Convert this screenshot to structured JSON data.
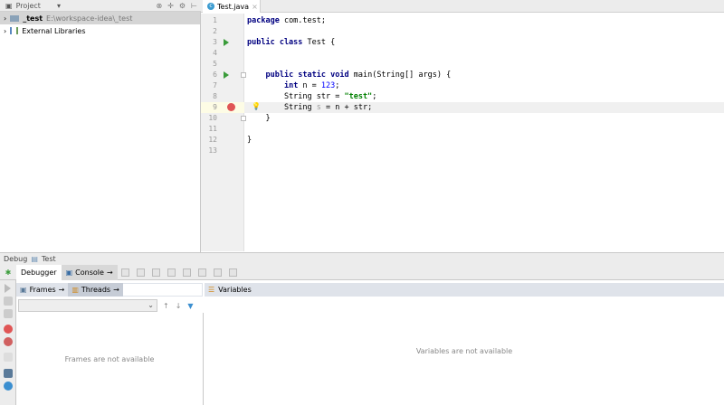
{
  "project": {
    "title": "Project",
    "tree": [
      {
        "name": "_test",
        "path": "E:\\workspace-idea\\_test"
      },
      {
        "name": "External Libraries"
      }
    ]
  },
  "editor": {
    "tab": "Test.java",
    "lines": [
      {
        "n": "1",
        "code": "package com.test;"
      },
      {
        "n": "2",
        "code": ""
      },
      {
        "n": "3",
        "code": "public class Test {"
      },
      {
        "n": "4",
        "code": ""
      },
      {
        "n": "5",
        "code": ""
      },
      {
        "n": "6",
        "code": "    public static void main(String[] args) {"
      },
      {
        "n": "7",
        "code": "        int n = 123;"
      },
      {
        "n": "8",
        "code": "        String str = \"test\";"
      },
      {
        "n": "9",
        "code": "        String s = n + str;"
      },
      {
        "n": "10",
        "code": "    }"
      },
      {
        "n": "11",
        "code": ""
      },
      {
        "n": "12",
        "code": "}"
      },
      {
        "n": "13",
        "code": ""
      }
    ]
  },
  "debug": {
    "title": "Debug",
    "config": "Test",
    "tabs": {
      "debugger": "Debugger",
      "console": "Console"
    },
    "frames_tab": "Frames",
    "threads_tab": "Threads",
    "variables": "Variables",
    "frames_empty": "Frames are not available",
    "variables_empty": "Variables are not available"
  }
}
